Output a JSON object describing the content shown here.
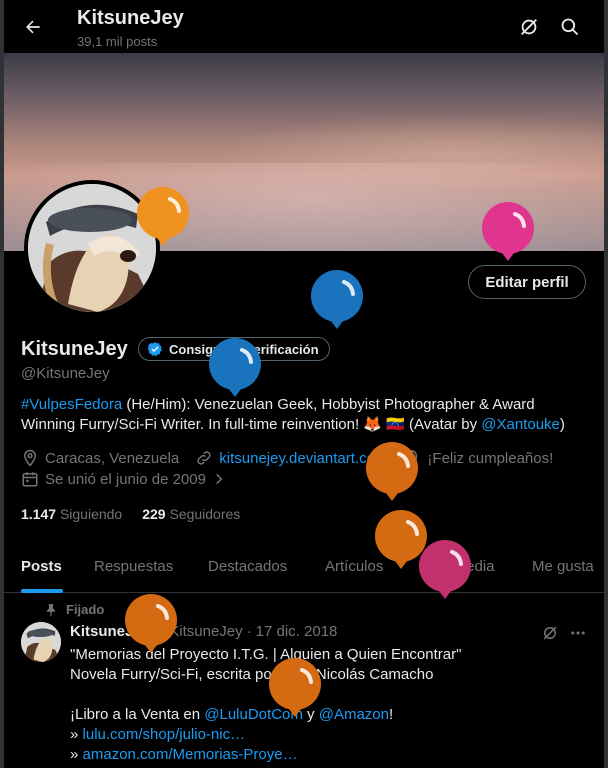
{
  "header": {
    "title": "KitsuneJey",
    "subtitle": "39,1 mil posts"
  },
  "profile": {
    "name": "KitsuneJey",
    "verify_label": "Consigue la verificación",
    "handle": "@KitsuneJey",
    "edit_label": "Editar perfil",
    "bio": {
      "hashtag": "#VulpesFedora",
      "text1": " (He/Him): Venezuelan Geek, Hobbyist Photographer & Award",
      "text2": "Winning Furry/Sci-Fi Writer. In full-time reinvention! 🦊 🇻🇪 (Avatar by ",
      "mention": "@Xantouke",
      "text3": ")"
    },
    "location": "Caracas, Venezuela",
    "website": "kitsunejey.deviantart.com",
    "birthday": "¡Feliz cumpleaños!",
    "joined": "Se unió el junio de 2009",
    "following_count": "1.147",
    "following_label": "Siguiendo",
    "followers_count": "229",
    "followers_label": "Seguidores"
  },
  "tabs": [
    "Posts",
    "Respuestas",
    "Destacados",
    "Artículos",
    "Multimedia",
    "Me gusta"
  ],
  "pinned_post": {
    "pinned_label": "Fijado",
    "name": "KitsuneJey",
    "handle": "@KitsuneJey",
    "separator": "·",
    "date": "17 dic. 2018",
    "line1": "\"Memorias del Proyecto I.T.G. | Alguien a Quien Encontrar\"",
    "line2": "Novela Furry/Sci-Fi, escrita por Julio Nicolás Camacho",
    "line4_a": "¡Libro a la Venta en ",
    "line4_m1": "@LuluDotCom",
    "line4_b": " y ",
    "line4_m2": "@Amazon",
    "line4_c": "!",
    "link1_prefix": "» ",
    "link1": "lulu.com/shop/julio-nic…",
    "link2_prefix": "» ",
    "link2": "amazon.com/Memorias-Proye…"
  },
  "colors": {
    "accent": "#1d9bf0",
    "muted": "#71767b",
    "text": "#e7e9ea",
    "background": "#000000"
  },
  "balloon_colors": [
    "#f0921f",
    "#e0358f",
    "#1a74bd",
    "#d46a12",
    "#c2306e"
  ]
}
